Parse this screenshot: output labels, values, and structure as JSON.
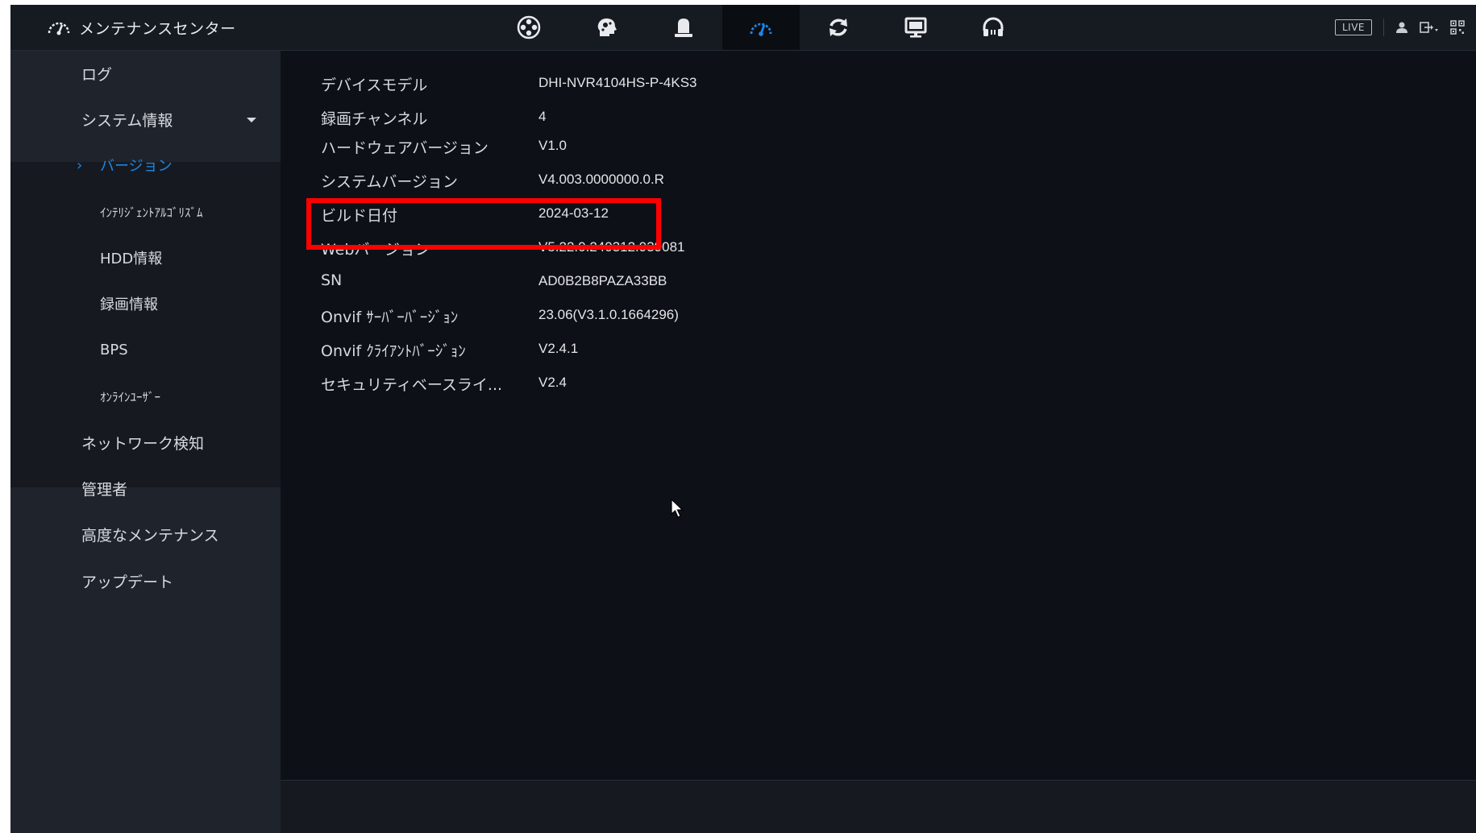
{
  "header": {
    "title": "メンテナンスセンター",
    "title_icon": "gauge-icon",
    "tabs": [
      {
        "icon": "film-reel-icon",
        "active": false
      },
      {
        "icon": "ai-head-icon",
        "active": false
      },
      {
        "icon": "alarm-light-icon",
        "active": false
      },
      {
        "icon": "gauge-icon",
        "active": true
      },
      {
        "icon": "refresh-icon",
        "active": false
      },
      {
        "icon": "monitor-icon",
        "active": false
      },
      {
        "icon": "headset-icon",
        "active": false
      }
    ],
    "live_label": "LIVE",
    "right_icons": [
      "user-icon",
      "logout-icon",
      "qr-code-icon"
    ]
  },
  "sidebar": {
    "items": [
      {
        "label": "ログ"
      },
      {
        "label": "システム情報",
        "expanded": true
      },
      {
        "label": "バージョン",
        "active": true
      },
      {
        "label": "ｲﾝﾃﾘｼﾞｪﾝﾄｱﾙｺﾞﾘｽﾞﾑ"
      },
      {
        "label": "HDD情報"
      },
      {
        "label": "録画情報"
      },
      {
        "label": "BPS"
      },
      {
        "label": "ｵﾝﾗｲﾝﾕｰｻﾞｰ"
      },
      {
        "label": "ネットワーク検知"
      },
      {
        "label": "管理者"
      },
      {
        "label": "高度なメンテナンス"
      },
      {
        "label": "アップデート"
      }
    ]
  },
  "info": {
    "rows": [
      {
        "key": "デバイスモデル",
        "value": "DHI-NVR4104HS-P-4KS3"
      },
      {
        "key": "録画チャンネル",
        "value": "4"
      },
      {
        "key": "ハードウェアバージョン",
        "value": "V1.0"
      },
      {
        "key": "システムバージョン",
        "value": "V4.003.0000000.0.R"
      },
      {
        "key": "ビルド日付",
        "value": "2024-03-12"
      },
      {
        "key": "Webバージョン",
        "value": "V5.22.0.240312.939081"
      },
      {
        "key": "SN",
        "value": "AD0B2B8PAZA33BB"
      },
      {
        "key": "Onvif ｻｰﾊﾞｰﾊﾞｰｼﾞｮﾝ",
        "value": "23.06(V3.1.0.1664296)"
      },
      {
        "key": "Onvif ｸﾗｲｱﾝﾄﾊﾞｰｼﾞｮﾝ",
        "value": "V2.4.1"
      },
      {
        "key": "セキュリティベースライ...",
        "value": "V2.4"
      }
    ]
  },
  "colors": {
    "accent": "#1e86e6",
    "highlight": "#ff0000",
    "background": "#0d1117",
    "sidebar": "#1f242c"
  }
}
